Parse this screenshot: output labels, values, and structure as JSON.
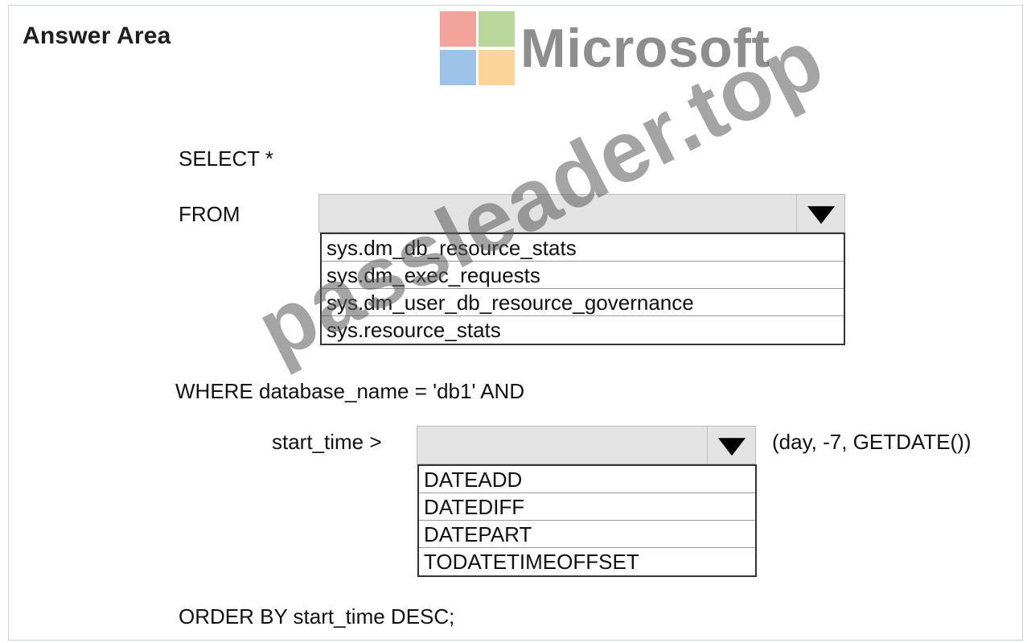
{
  "header": {
    "title": "Answer Area",
    "logo_text": "Microsoft"
  },
  "colors": {
    "logo_red": "#f2a49c",
    "logo_green": "#b9d79a",
    "logo_blue": "#9dc3e9",
    "logo_yellow": "#fbd49a",
    "logo_text": "#8e8e8e",
    "select_bg": "#e3e3e3"
  },
  "query": {
    "select_line": "SELECT *",
    "from_label": "FROM",
    "from_dropdown": {
      "selected": "",
      "options": [
        "sys.dm_db_resource_stats",
        "sys.dm_exec_requests",
        "sys.dm_user_db_resource_governance",
        "sys.resource_stats"
      ]
    },
    "where_line": "WHERE database_name = 'db1' AND",
    "start_time_label": "start_time >",
    "function_dropdown": {
      "selected": "",
      "options": [
        "DATEADD",
        "DATEDIFF",
        "DATEPART",
        "TODATETIMEOFFSET"
      ]
    },
    "function_args": "(day, -7, GETDATE())",
    "order_line": "ORDER BY start_time DESC;"
  },
  "watermark": "passleader.top"
}
